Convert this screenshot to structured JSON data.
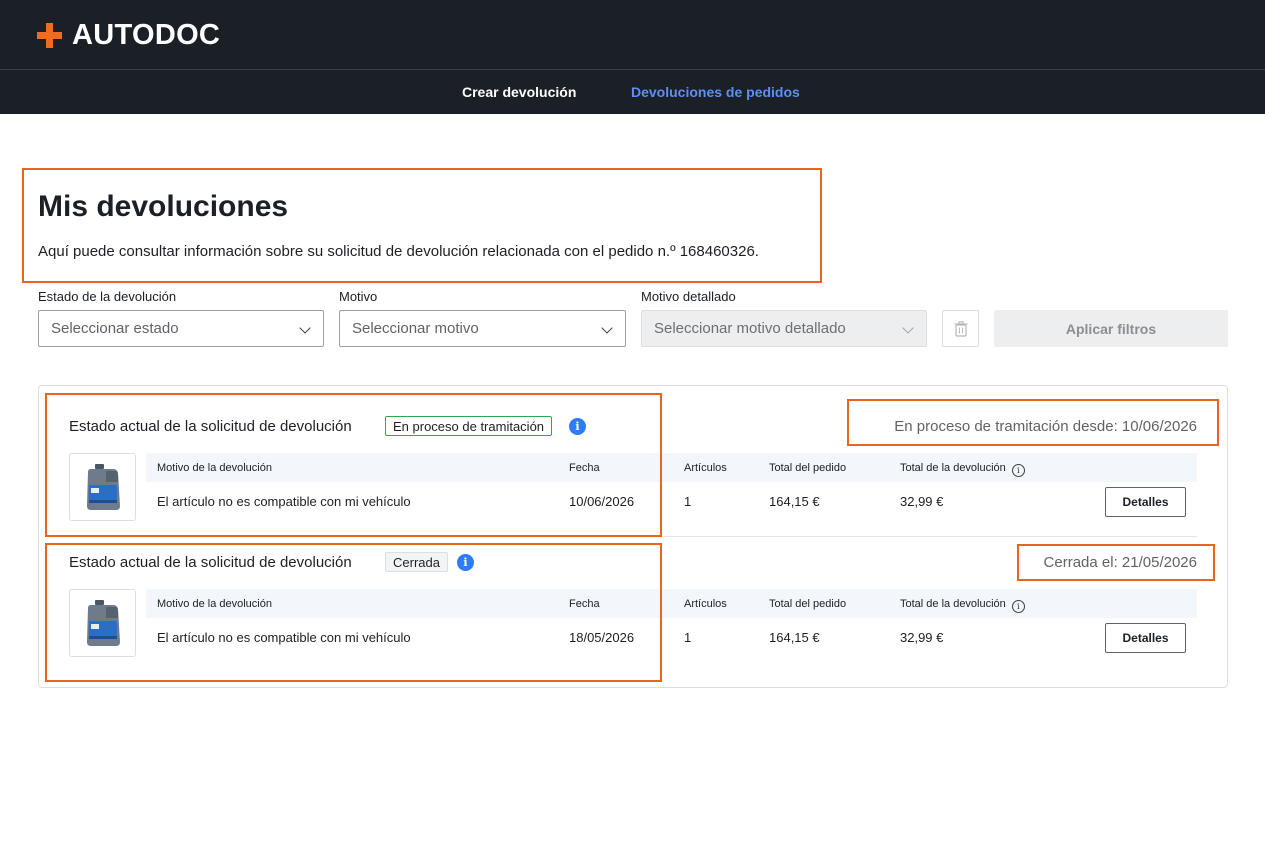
{
  "header": {
    "brand": "AUTODOC",
    "nav": [
      {
        "label": "Crear devolución",
        "active": false
      },
      {
        "label": "Devoluciones de pedidos",
        "active": true
      }
    ]
  },
  "page": {
    "title": "Mis devoluciones",
    "subtitle": "Aquí puede consultar información sobre su solicitud de devolución relacionada con el pedido n.º 168460326."
  },
  "filters": {
    "status": {
      "label": "Estado de la devolución",
      "placeholder": "Seleccionar estado"
    },
    "reason": {
      "label": "Motivo",
      "placeholder": "Seleccionar motivo"
    },
    "detailed_reason": {
      "label": "Motivo detallado",
      "placeholder": "Seleccionar motivo detallado",
      "disabled": true
    },
    "apply_label": "Aplicar filtros"
  },
  "returns": [
    {
      "status_label": "Estado actual de la solicitud de devolución",
      "badge": "En proceso de tramitación",
      "since": "En proceso de tramitación desde: 10/06/2026",
      "columns": {
        "reason": "Motivo de la devolución",
        "date": "Fecha",
        "items": "Artículos",
        "order_total": "Total del pedido",
        "return_total": "Total de la devolución"
      },
      "row": {
        "reason": "El artículo no es compatible con mi vehículo",
        "date": "10/06/2026",
        "items": "1",
        "order_total": "164,15 €",
        "return_total": "32,99 €"
      },
      "details_label": "Detalles"
    },
    {
      "status_label": "Estado actual de la solicitud de devolución",
      "badge": "Cerrada",
      "since": "Cerrada el: 21/05/2026",
      "columns": {
        "reason": "Motivo de la devolución",
        "date": "Fecha",
        "items": "Artículos",
        "order_total": "Total del pedido",
        "return_total": "Total de la devolución"
      },
      "row": {
        "reason": "El artículo no es compatible con mi vehículo",
        "date": "18/05/2026",
        "items": "1",
        "order_total": "164,15 €",
        "return_total": "32,99 €"
      },
      "details_label": "Detalles"
    }
  ],
  "icons": {
    "info": "info-icon",
    "trash": "trash-icon",
    "chevron": "chevron-down-icon",
    "product": "oil-canister-image"
  },
  "colors": {
    "accent": "#e8651a",
    "brand_orange": "#f26c1f",
    "header_bg": "#1b2027",
    "active_nav": "#5d8ff5",
    "badge_green": "#2fa84f",
    "info_blue": "#2f7df6"
  }
}
